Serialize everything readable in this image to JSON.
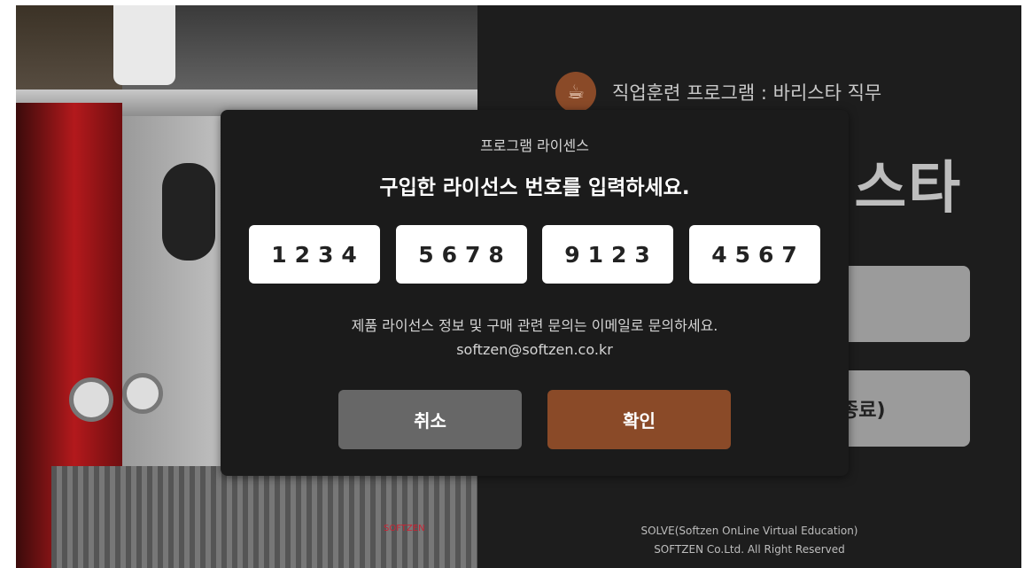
{
  "brand": {
    "program_title": "직업훈련 프로그램 : 바리스타 직무",
    "big_title_partial": "|스타",
    "cup_icon": "coffee-cup-icon"
  },
  "background_buttons": {
    "button1_label": "",
    "button2_label_partial": "종료)"
  },
  "footer": {
    "line1": "SOLVE(Softzen OnLine Virtual Education)",
    "line2": "SOFTZEN Co.Ltd. All Right Reserved"
  },
  "scene": {
    "logo_text": "SOFTZEN"
  },
  "modal": {
    "subtitle": "프로그램 라이센스",
    "title": "구입한 라이선스 번호를 입력하세요.",
    "license_codes": [
      "1234",
      "5678",
      "9123",
      "4567"
    ],
    "info_line1": "제품 라이선스 정보 및  구매 관련 문의는 이메일로 문의하세요.",
    "info_email": "softzen@softzen.co.kr",
    "cancel_label": "취소",
    "confirm_label": "확인"
  },
  "colors": {
    "accent": "#8a4a28",
    "cancel": "#676767",
    "modal_bg": "#1b1b1b"
  }
}
